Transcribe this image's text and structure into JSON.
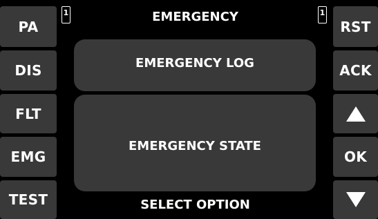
{
  "left_buttons": {
    "pa": "PA",
    "dis": "DIS",
    "flt": "FLT",
    "emg": "EMG",
    "test": "TEST"
  },
  "right_buttons": {
    "rst": "RST",
    "ack": "ACK",
    "up_icon": "arrow-up-icon",
    "ok": "OK",
    "down_icon": "arrow-down-icon"
  },
  "header": {
    "title": "EMERGENCY",
    "indicator_left": "1",
    "indicator_right": "1"
  },
  "main": {
    "log_label": "EMERGENCY LOG",
    "state_label": "EMERGENCY STATE"
  },
  "footer": {
    "prompt": "SELECT OPTION"
  },
  "colors": {
    "background": "#000000",
    "button_fill": "#393939",
    "text": "#ffffff"
  }
}
